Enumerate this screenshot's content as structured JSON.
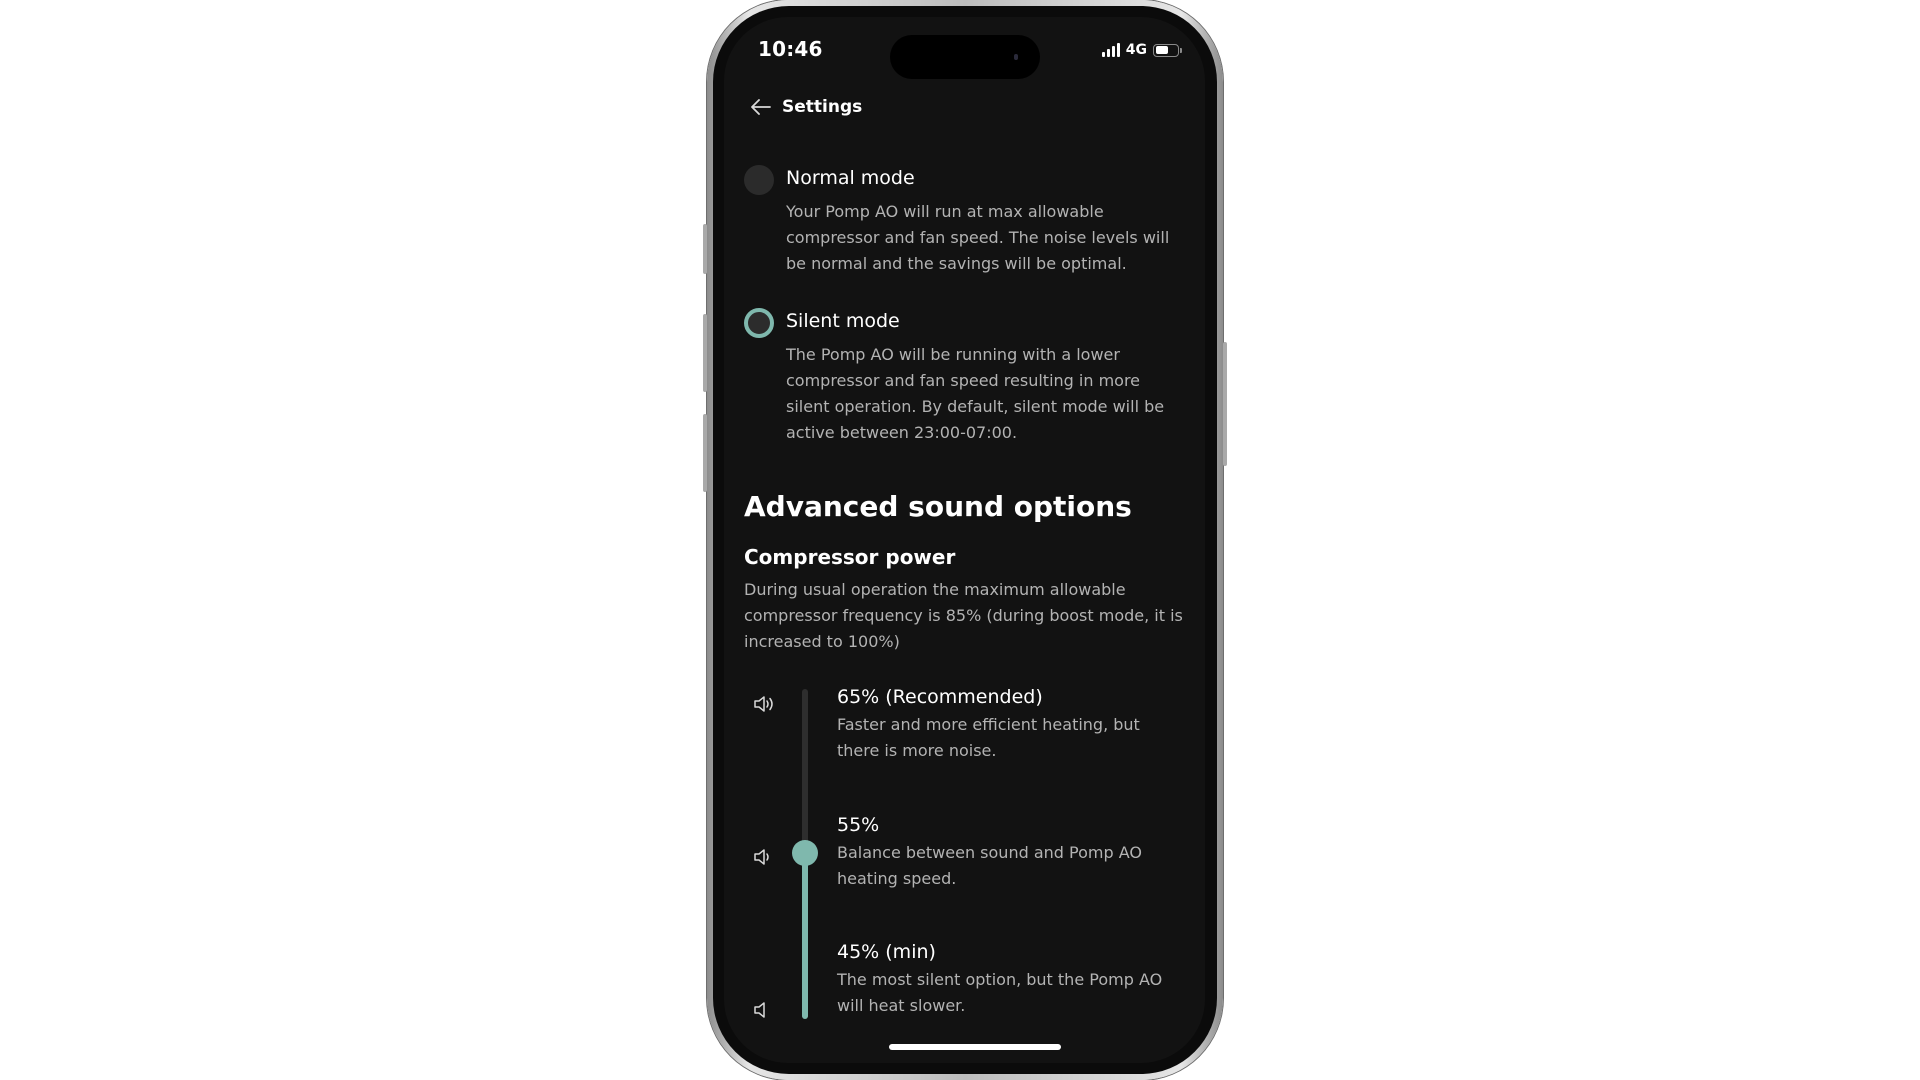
{
  "status_bar": {
    "time": "10:46",
    "network": "4G",
    "battery_level": 0.6
  },
  "nav": {
    "back_icon": "arrow-left-icon",
    "title": "Settings"
  },
  "modes": [
    {
      "title": "Normal mode",
      "description": "Your Pomp AO will run at max allowable compressor and fan speed. The noise levels will be normal and the savings will be optimal.",
      "selected": false
    },
    {
      "title": "Silent mode",
      "description": "The Pomp AO will be running with a lower compressor and fan speed resulting in more silent operation. By default, silent mode will be active between 23:00-07:00.",
      "selected": true
    }
  ],
  "advanced": {
    "title": "Advanced sound options",
    "compressor": {
      "title": "Compressor power",
      "description": "During usual operation the maximum allowable compressor frequency is 85% (during boost mode, it is increased to 100%)",
      "selected_index": 1,
      "options": [
        {
          "title": "65% (Recommended)",
          "description": "Faster and more efficient heating, but there is more noise.",
          "icon": "volume-high-icon"
        },
        {
          "title": "55%",
          "description": "Balance between sound and Pomp AO heating speed.",
          "icon": "volume-medium-icon"
        },
        {
          "title": "45% (min)",
          "description": "The most silent option, but the Pomp AO will heat slower.",
          "icon": "volume-low-icon"
        }
      ]
    }
  },
  "colors": {
    "accent": "#7fb8ad",
    "background": "#121212",
    "text_primary": "#ffffff",
    "text_secondary": "#b3b3b3"
  }
}
